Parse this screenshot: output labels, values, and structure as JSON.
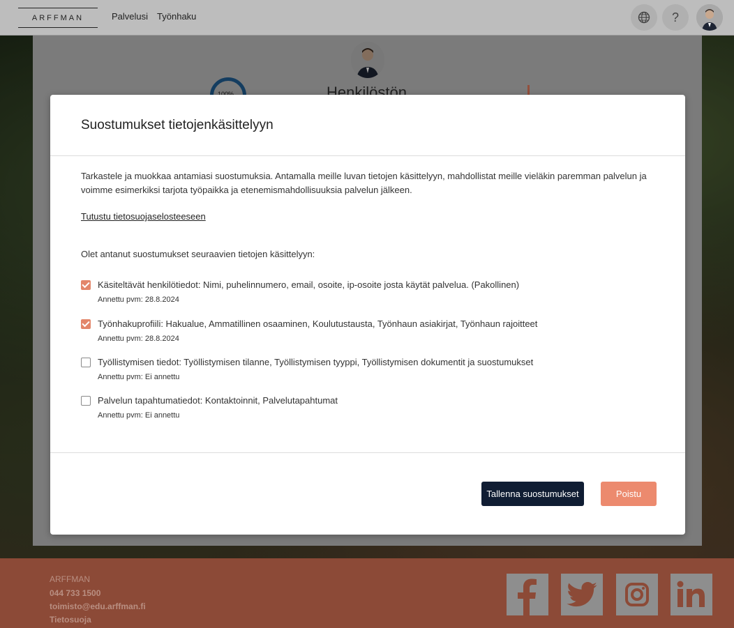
{
  "header": {
    "logo": "ARFFMAN",
    "nav": [
      "Palvelusi",
      "Työnhaku"
    ],
    "language_icon": "globe-icon",
    "help_label": "?"
  },
  "page": {
    "progress": "100%",
    "title_partial": "Henkilöstön"
  },
  "modal": {
    "title": "Suostumukset tietojenkäsittelyyn",
    "intro": "Tarkastele ja muokkaa antamiasi suostumuksia. Antamalla meille luvan tietojen käsittelyyn, mahdollistat meille vieläkin paremman palvelun ja voimme esimerkiksi tarjota työpaikka ja etenemismahdollisuuksia palvelun jälkeen.",
    "privacy_link": "Tutustu tietosuojaselosteeseen",
    "given_title": "Olet antanut suostumukset seuraavien tietojen käsittelyyn:",
    "consents": [
      {
        "label": "Käsiteltävät henkilötiedot: Nimi, puhelinnumero, email, osoite, ip-osoite josta käytät palvelua. (Pakollinen)",
        "date": "Annettu pvm: 28.8.2024",
        "checked": true
      },
      {
        "label": "Työnhakuprofiili: Hakualue, Ammatillinen osaaminen, Koulutustausta, Työnhaun asiakirjat, Työnhaun rajoitteet",
        "date": "Annettu pvm: 28.8.2024",
        "checked": true
      },
      {
        "label": "Työllistymisen tiedot: Työllistymisen tilanne, Työllistymisen tyyppi, Työllistymisen dokumentit ja suostumukset",
        "date": "Annettu pvm: Ei annettu",
        "checked": false
      },
      {
        "label": "Palvelun tapahtumatiedot: Kontaktoinnit, Palvelutapahtumat",
        "date": "Annettu pvm: Ei annettu",
        "checked": false
      }
    ],
    "save_label": "Tallenna suostumukset",
    "delete_label": "Poistu"
  },
  "footer": {
    "company": "ARFFMAN",
    "phone": "044 733 1500",
    "email": "toimisto@edu.arffman.fi",
    "privacy": "Tietosuoja",
    "social": [
      "facebook-icon",
      "twitter-icon",
      "instagram-icon",
      "linkedin-icon"
    ]
  },
  "colors": {
    "accent": "#e3866a",
    "primary_button": "#101d33",
    "footer": "#8c4a37"
  }
}
